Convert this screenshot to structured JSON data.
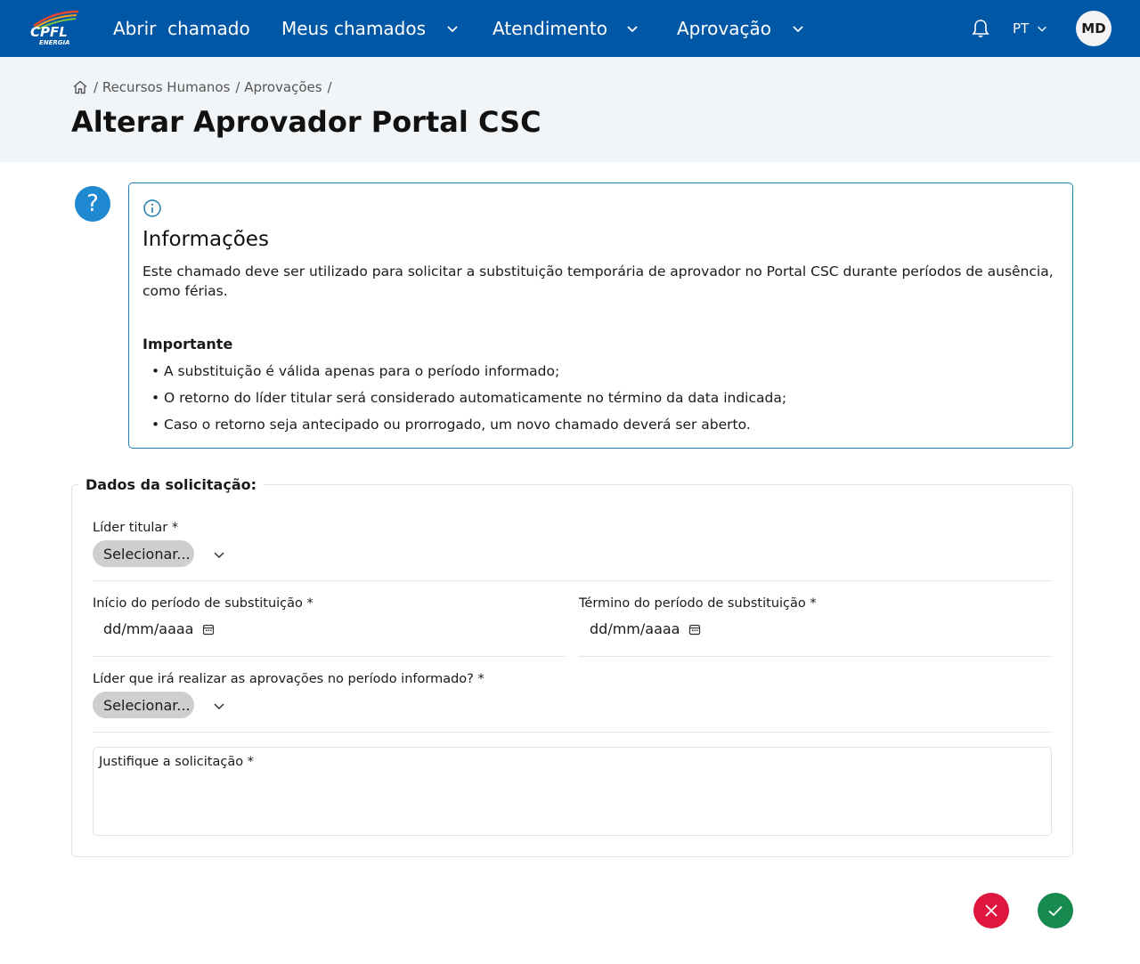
{
  "brand": {
    "name": "CPFL",
    "sub": "ENERGIA"
  },
  "nav": {
    "items": [
      {
        "label": "Abrir  chamado"
      },
      {
        "label": "Meus chamados"
      },
      {
        "label": "Atendimento"
      },
      {
        "label": "Aprovação"
      }
    ],
    "language": "PT",
    "avatar_initials": "MD"
  },
  "breadcrumb": {
    "items": [
      "/ Recursos Humanos",
      "/ Aprovações",
      "/"
    ]
  },
  "page": {
    "title": "Alterar Aprovador Portal CSC"
  },
  "info": {
    "title": "Informações",
    "description": "Este chamado deve ser utilizado para solicitar a substituição temporária de aprovador no Portal CSC durante períodos de ausência, como férias.",
    "important_label": "Importante",
    "bullets": [
      "A substituição é válida apenas para o período informado;",
      "O retorno do líder titular será considerado automaticamente no término da data indicada;",
      "Caso o retorno seja antecipado ou prorrogado, um novo chamado deverá ser aberto."
    ]
  },
  "form": {
    "legend": "Dados da solicitação:",
    "lider_titular": {
      "label": "Líder titular *",
      "value": "Selecionar..."
    },
    "inicio": {
      "label": "Início do período de substituição *",
      "placeholder": "dd/mm/aaaa"
    },
    "termino": {
      "label": "Término do período de substituição *",
      "placeholder": "dd/mm/aaaa"
    },
    "lider_aprovador": {
      "label": "Líder que irá realizar as aprovações no período informado? *",
      "value": "Selecionar..."
    },
    "justificativa": {
      "label": "Justifique a solicitação *"
    }
  },
  "colors": {
    "topbar": "#0057a5",
    "header_band": "#f2f5f8",
    "info_border": "#1a7fb0",
    "help": "#1e88d0",
    "cancel": "#e0163f",
    "confirm": "#178a50"
  },
  "icons": {
    "logo": "cpfl-logo",
    "bell": "bell-icon",
    "home": "home-icon",
    "help": "question-icon",
    "info": "info-icon",
    "calendar": "calendar-icon",
    "cancel": "close-icon",
    "confirm": "check-icon"
  }
}
